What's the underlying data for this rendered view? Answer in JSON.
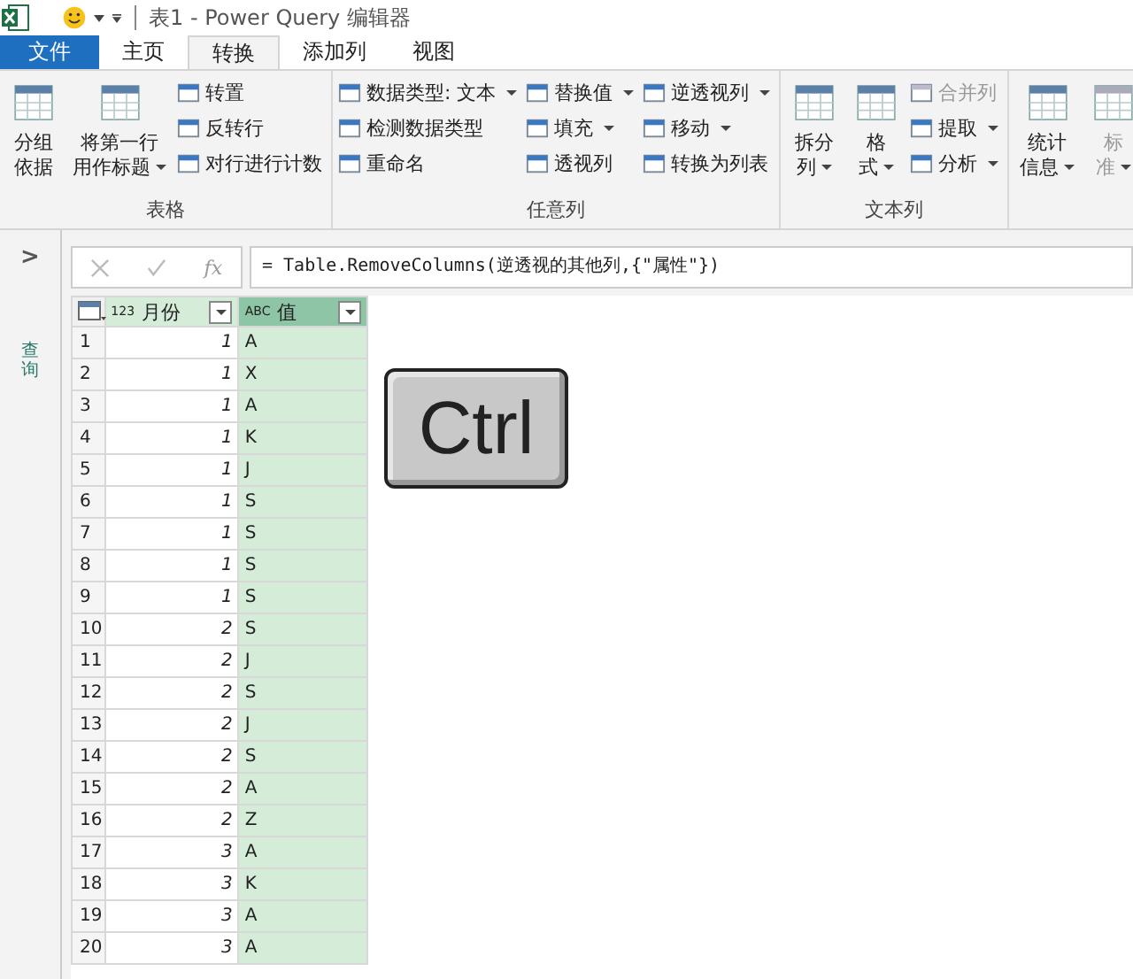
{
  "window": {
    "title": "表1 - Power Query 编辑器"
  },
  "tabs": [
    {
      "label": "文件",
      "kind": "file",
      "selected": false
    },
    {
      "label": "主页",
      "kind": "tab",
      "selected": false
    },
    {
      "label": "转换",
      "kind": "tab",
      "selected": true
    },
    {
      "label": "添加列",
      "kind": "tab",
      "selected": false
    },
    {
      "label": "视图",
      "kind": "tab",
      "selected": false
    }
  ],
  "ribbon_groups": [
    {
      "label": "表格",
      "items": [
        {
          "kind": "big",
          "lines": [
            "分组",
            "依据"
          ],
          "dropdown": false,
          "disabled": false
        },
        {
          "kind": "big",
          "lines": [
            "将第一行",
            "用作标题"
          ],
          "dropdown": true,
          "disabled": false
        },
        {
          "kind": "column",
          "buttons": [
            {
              "label": "转置",
              "dropdown": false,
              "disabled": false
            },
            {
              "label": "反转行",
              "dropdown": false,
              "disabled": false
            },
            {
              "label": "对行进行计数",
              "dropdown": false,
              "disabled": false
            }
          ]
        }
      ]
    },
    {
      "label": "任意列",
      "items": [
        {
          "kind": "column",
          "buttons": [
            {
              "label": "数据类型: 文本",
              "dropdown": true,
              "disabled": false
            },
            {
              "label": "检测数据类型",
              "dropdown": false,
              "disabled": false
            },
            {
              "label": "重命名",
              "dropdown": false,
              "disabled": false
            }
          ]
        },
        {
          "kind": "column",
          "buttons": [
            {
              "label": "替换值",
              "dropdown": true,
              "disabled": false
            },
            {
              "label": "填充",
              "dropdown": true,
              "disabled": false
            },
            {
              "label": "透视列",
              "dropdown": false,
              "disabled": false
            }
          ]
        },
        {
          "kind": "column",
          "buttons": [
            {
              "label": "逆透视列",
              "dropdown": true,
              "disabled": false
            },
            {
              "label": "移动",
              "dropdown": true,
              "disabled": false
            },
            {
              "label": "转换为列表",
              "dropdown": false,
              "disabled": false
            }
          ]
        }
      ]
    },
    {
      "label": "文本列",
      "items": [
        {
          "kind": "big",
          "lines": [
            "拆分",
            "列"
          ],
          "dropdown": true,
          "disabled": false
        },
        {
          "kind": "big",
          "lines": [
            "格",
            "式"
          ],
          "dropdown": true,
          "disabled": false
        },
        {
          "kind": "column",
          "buttons": [
            {
              "label": "合并列",
              "dropdown": false,
              "disabled": true
            },
            {
              "label": "提取",
              "dropdown": true,
              "disabled": false
            },
            {
              "label": "分析",
              "dropdown": true,
              "disabled": false
            }
          ]
        }
      ]
    },
    {
      "items": [
        {
          "kind": "big",
          "lines": [
            "统计",
            "信息"
          ],
          "dropdown": true,
          "disabled": false
        },
        {
          "kind": "big",
          "lines": [
            "标",
            "准"
          ],
          "dropdown": true,
          "disabled": true
        }
      ]
    }
  ],
  "queries_pane": {
    "toggle": ">",
    "label": "查询"
  },
  "formula_bar": {
    "fx": "fx",
    "formula": "= Table.RemoveColumns(逆透视的其他列,{\"属性\"})"
  },
  "table": {
    "columns": [
      {
        "type": "123",
        "name": "月份",
        "selected": false
      },
      {
        "type": "ABC",
        "name": "值",
        "selected": true
      }
    ],
    "rows": [
      {
        "row_number": "1",
        "cells": [
          "1",
          "A"
        ]
      },
      {
        "row_number": "2",
        "cells": [
          "1",
          "X"
        ]
      },
      {
        "row_number": "3",
        "cells": [
          "1",
          "A"
        ]
      },
      {
        "row_number": "4",
        "cells": [
          "1",
          "K"
        ]
      },
      {
        "row_number": "5",
        "cells": [
          "1",
          "J"
        ]
      },
      {
        "row_number": "6",
        "cells": [
          "1",
          "S"
        ]
      },
      {
        "row_number": "7",
        "cells": [
          "1",
          "S"
        ]
      },
      {
        "row_number": "8",
        "cells": [
          "1",
          "S"
        ]
      },
      {
        "row_number": "9",
        "cells": [
          "1",
          "S"
        ]
      },
      {
        "row_number": "10",
        "cells": [
          "2",
          "S"
        ]
      },
      {
        "row_number": "11",
        "cells": [
          "2",
          "J"
        ]
      },
      {
        "row_number": "12",
        "cells": [
          "2",
          "S"
        ]
      },
      {
        "row_number": "13",
        "cells": [
          "2",
          "J"
        ]
      },
      {
        "row_number": "14",
        "cells": [
          "2",
          "S"
        ]
      },
      {
        "row_number": "15",
        "cells": [
          "2",
          "A"
        ]
      },
      {
        "row_number": "16",
        "cells": [
          "2",
          "Z"
        ]
      },
      {
        "row_number": "17",
        "cells": [
          "3",
          "A"
        ]
      },
      {
        "row_number": "18",
        "cells": [
          "3",
          "K"
        ]
      },
      {
        "row_number": "19",
        "cells": [
          "3",
          "A"
        ]
      },
      {
        "row_number": "20",
        "cells": [
          "3",
          "A"
        ]
      }
    ]
  },
  "key_overlay": {
    "label": "Ctrl"
  }
}
